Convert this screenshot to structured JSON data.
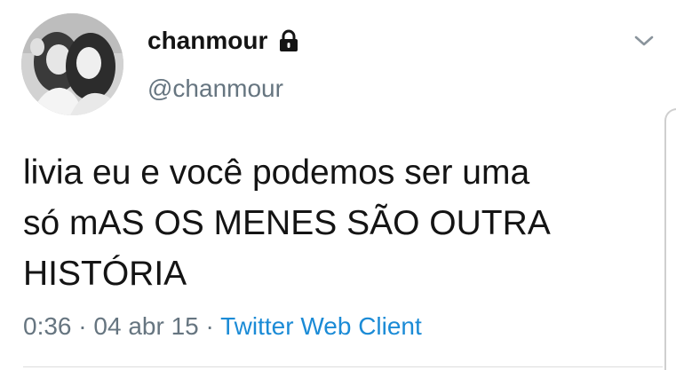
{
  "tweet": {
    "author": {
      "display_name": "chanmour",
      "handle": "@chanmour",
      "protected_icon": "lock-icon",
      "avatar": "profile-photo"
    },
    "menu_icon": "chevron-down-icon",
    "text_lines": [
      "livia eu e você podemos ser uma",
      "só mAS OS MENES SÃO OUTRA",
      "HISTÓRIA"
    ],
    "meta": {
      "time": "0:36",
      "separator": "·",
      "date": "04 abr 15",
      "source": "Twitter Web Client"
    }
  },
  "colors": {
    "text": "#141414",
    "secondary": "#667580",
    "link": "#1b8bd6",
    "divider": "#dddddd"
  }
}
